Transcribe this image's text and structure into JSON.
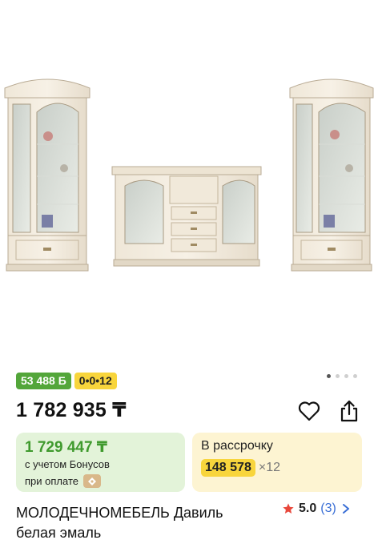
{
  "product": {
    "title_line1": "МОЛОДЕЧНОМЕБЕЛЬ Давиль",
    "title_line2": "белая эмаль",
    "price": "1 782 935 ₸",
    "image_alt": "furniture-set-photo"
  },
  "gallery": {
    "dots_total": 4,
    "active_index": 0
  },
  "badges": {
    "bonus": "53 488 Б",
    "installment": "0•0•12"
  },
  "bonus_card": {
    "price": "1 729 447 ₸",
    "line1": "с учетом Бонусов",
    "line2": "при оплате"
  },
  "installment_card": {
    "title": "В рассрочку",
    "amount": "148 578",
    "multiplier": "×12"
  },
  "rating": {
    "score": "5.0",
    "count": "(3)",
    "star_color": "#e8473b"
  },
  "colors": {
    "bonus_green": "#53a63a",
    "installment_yellow": "#f8d53c",
    "link_blue": "#3a6fd6"
  }
}
